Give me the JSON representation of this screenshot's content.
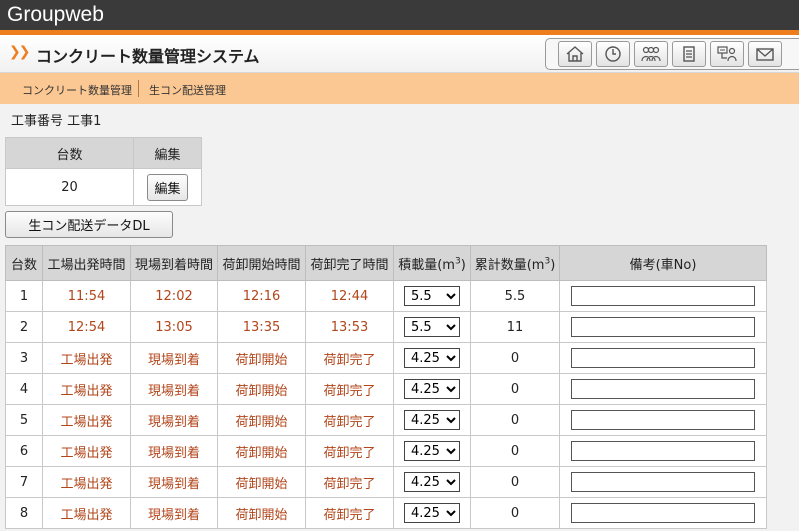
{
  "app": {
    "brand": "Groupweb",
    "title": "コンクリート数量管理システム"
  },
  "iconbar": {
    "icons": [
      "home-icon",
      "clock-icon",
      "users-icon",
      "document-icon",
      "org-chart-icon",
      "mail-icon"
    ]
  },
  "subnav": {
    "items": [
      "コンクリート数量管理",
      "生コン配送管理"
    ]
  },
  "kouji_label": "工事番号 工事1",
  "summary": {
    "headers": [
      "台数",
      "編集"
    ],
    "count": "20",
    "edit_button": "編集"
  },
  "dl_button": "生コン配送データDL",
  "table": {
    "headers": {
      "no": "台数",
      "depart": "工場出発時間",
      "arrive": "現場到着時間",
      "unload_start": "荷卸開始時間",
      "unload_end": "荷卸完了時間",
      "load_prefix": "積載量(m",
      "total_prefix": "累計数量(m",
      "unit_sup": "3",
      "close_paren": ")",
      "note": "備考(車No)"
    },
    "rows": [
      {
        "no": "1",
        "depart": "11:54",
        "arrive": "12:02",
        "unload_start": "12:16",
        "unload_end": "12:44",
        "load": "5.5",
        "total": "5.5",
        "note": ""
      },
      {
        "no": "2",
        "depart": "12:54",
        "arrive": "13:05",
        "unload_start": "13:35",
        "unload_end": "13:53",
        "load": "5.5",
        "total": "11",
        "note": ""
      },
      {
        "no": "3",
        "depart": "工場出発",
        "arrive": "現場到着",
        "unload_start": "荷卸開始",
        "unload_end": "荷卸完了",
        "load": "4.25",
        "total": "0",
        "note": ""
      },
      {
        "no": "4",
        "depart": "工場出発",
        "arrive": "現場到着",
        "unload_start": "荷卸開始",
        "unload_end": "荷卸完了",
        "load": "4.25",
        "total": "0",
        "note": ""
      },
      {
        "no": "5",
        "depart": "工場出発",
        "arrive": "現場到着",
        "unload_start": "荷卸開始",
        "unload_end": "荷卸完了",
        "load": "4.25",
        "total": "0",
        "note": ""
      },
      {
        "no": "6",
        "depart": "工場出発",
        "arrive": "現場到着",
        "unload_start": "荷卸開始",
        "unload_end": "荷卸完了",
        "load": "4.25",
        "total": "0",
        "note": ""
      },
      {
        "no": "7",
        "depart": "工場出発",
        "arrive": "現場到着",
        "unload_start": "荷卸開始",
        "unload_end": "荷卸完了",
        "load": "4.25",
        "total": "0",
        "note": ""
      },
      {
        "no": "8",
        "depart": "工場出発",
        "arrive": "現場到着",
        "unload_start": "荷卸開始",
        "unload_end": "荷卸完了",
        "load": "4.25",
        "total": "0",
        "note": ""
      }
    ]
  }
}
